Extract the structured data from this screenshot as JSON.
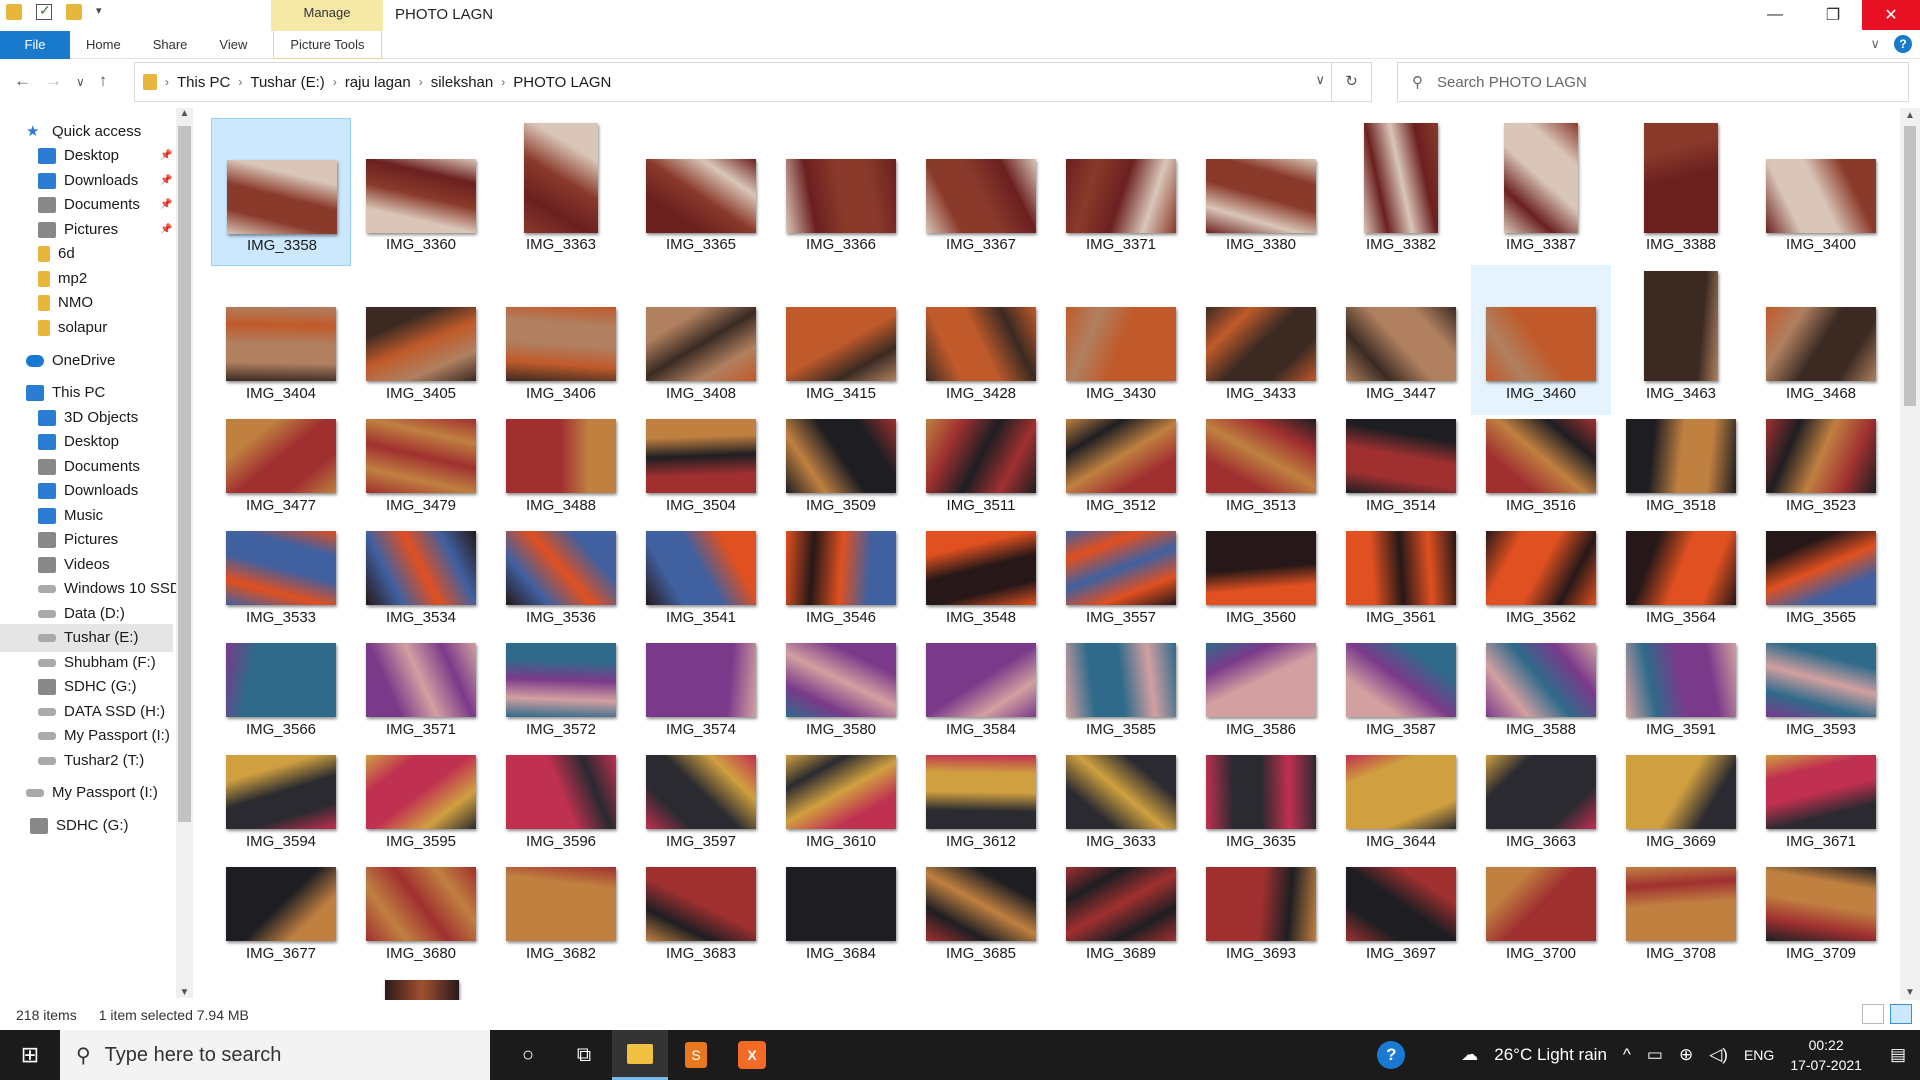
{
  "window": {
    "title": "PHOTO  LAGN",
    "context_tab": "Manage",
    "minimize": "—",
    "restore": "❐",
    "close": "✕"
  },
  "ribbon": {
    "tabs": [
      "File",
      "Home",
      "Share",
      "View"
    ],
    "picture_tools": "Picture Tools",
    "expand_icon": "∨",
    "help_icon": "?"
  },
  "address": {
    "crumbs": [
      "This PC",
      "Tushar (E:)",
      "raju lagan",
      "silekshan",
      "PHOTO  LAGN"
    ],
    "search_placeholder": "Search PHOTO  LAGN"
  },
  "nav": {
    "items": [
      {
        "label": "Quick access",
        "icon": "star-icon",
        "top": 0,
        "indent": 26,
        "pinned": false
      },
      {
        "label": "Desktop",
        "icon": "desktop-icon",
        "pinned": true
      },
      {
        "label": "Downloads",
        "icon": "download-icon",
        "pinned": true
      },
      {
        "label": "Documents",
        "icon": "documents-icon",
        "pinned": true
      },
      {
        "label": "Pictures",
        "icon": "pictures-icon",
        "pinned": true
      },
      {
        "label": "6d",
        "icon": "folder-icon",
        "pinned": false
      },
      {
        "label": "mp2",
        "icon": "folder-icon",
        "pinned": false
      },
      {
        "label": "NMO",
        "icon": "folder-icon",
        "pinned": false
      },
      {
        "label": "solapur",
        "icon": "folder-icon",
        "pinned": false
      },
      {
        "label": "OneDrive",
        "icon": "cloud-icon",
        "pinned": false
      },
      {
        "label": "This PC",
        "icon": "computer-icon",
        "pinned": false
      },
      {
        "label": "3D Objects",
        "icon": "3d-objects-icon",
        "pinned": false
      },
      {
        "label": "Desktop",
        "icon": "desktop-icon",
        "pinned": false
      },
      {
        "label": "Documents",
        "icon": "documents-icon",
        "pinned": false
      },
      {
        "label": "Downloads",
        "icon": "download-icon",
        "pinned": false
      },
      {
        "label": "Music",
        "icon": "music-icon",
        "pinned": false
      },
      {
        "label": "Pictures",
        "icon": "pictures-icon",
        "pinned": false
      },
      {
        "label": "Videos",
        "icon": "videos-icon",
        "pinned": false
      },
      {
        "label": "Windows 10 SSD",
        "icon": "drive-icon",
        "pinned": false
      },
      {
        "label": "Data (D:)",
        "icon": "drive-icon",
        "pinned": false
      },
      {
        "label": "Tushar (E:)",
        "icon": "drive-icon",
        "pinned": false,
        "selected": true
      },
      {
        "label": "Shubham (F:)",
        "icon": "drive-icon",
        "pinned": false
      },
      {
        "label": "SDHC (G:)",
        "icon": "sd-card-icon",
        "pinned": false
      },
      {
        "label": "DATA SSD (H:)",
        "icon": "drive-icon",
        "pinned": false
      },
      {
        "label": "My Passport (I:)",
        "icon": "drive-icon",
        "pinned": false
      },
      {
        "label": "Tushar2 (T:)",
        "icon": "drive-icon",
        "pinned": false
      },
      {
        "label": "My Passport (I:)",
        "icon": "drive-icon",
        "pinned": false
      },
      {
        "label": "SDHC (G:)",
        "icon": "sd-card-icon",
        "pinned": false
      }
    ]
  },
  "files": [
    [
      "IMG_3358",
      "IMG_3360",
      "IMG_3363",
      "IMG_3365",
      "IMG_3366",
      "IMG_3367",
      "IMG_3371",
      "IMG_3380",
      "IMG_3382",
      "IMG_3387",
      "IMG_3388",
      "IMG_3400"
    ],
    [
      "IMG_3404",
      "IMG_3405",
      "IMG_3406",
      "IMG_3408",
      "IMG_3415",
      "IMG_3428",
      "IMG_3430",
      "IMG_3433",
      "IMG_3447",
      "IMG_3460",
      "IMG_3463",
      "IMG_3468"
    ],
    [
      "IMG_3477",
      "IMG_3479",
      "IMG_3488",
      "IMG_3504",
      "IMG_3509",
      "IMG_3511",
      "IMG_3512",
      "IMG_3513",
      "IMG_3514",
      "IMG_3516",
      "IMG_3518",
      "IMG_3523"
    ],
    [
      "IMG_3533",
      "IMG_3534",
      "IMG_3536",
      "IMG_3541",
      "IMG_3546",
      "IMG_3548",
      "IMG_3557",
      "IMG_3560",
      "IMG_3561",
      "IMG_3562",
      "IMG_3564",
      "IMG_3565"
    ],
    [
      "IMG_3566",
      "IMG_3571",
      "IMG_3572",
      "IMG_3574",
      "IMG_3580",
      "IMG_3584",
      "IMG_3585",
      "IMG_3586",
      "IMG_3587",
      "IMG_3588",
      "IMG_3591",
      "IMG_3593"
    ],
    [
      "IMG_3594",
      "IMG_3595",
      "IMG_3596",
      "IMG_3597",
      "IMG_3610",
      "IMG_3612",
      "IMG_3633",
      "IMG_3635",
      "IMG_3644",
      "IMG_3663",
      "IMG_3669",
      "IMG_3671"
    ],
    [
      "IMG_3677",
      "IMG_3680",
      "IMG_3682",
      "IMG_3683",
      "IMG_3684",
      "IMG_3685",
      "IMG_3689",
      "IMG_3693",
      "IMG_3697",
      "IMG_3700",
      "IMG_3708",
      "IMG_3709"
    ]
  ],
  "status": {
    "count": "218 items",
    "selection": "1 item selected  7.94 MB"
  },
  "taskbar": {
    "search_placeholder": "Type here to search",
    "weather": "26°C  Light rain",
    "language": "ENG",
    "time": "00:22",
    "date": "17-07-2021"
  },
  "colors": {
    "accent": "#1979ca",
    "selection": "#cce8ff",
    "manage_tab": "#f6e9a8"
  }
}
